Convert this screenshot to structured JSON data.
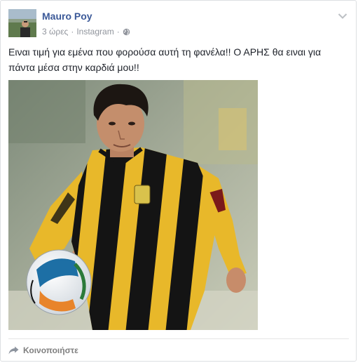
{
  "post": {
    "author": "Mauro Poy",
    "time": "3 ώρες",
    "source": "Instagram",
    "separator": "·",
    "privacy_icon": "globe-icon",
    "menu_icon": "chevron-down-icon",
    "text": "Ειναι τιμή για εμένα που φορούσα αυτή τη φανέλα!! Ο ΑΡΗΣ θα ειναι για πάντα μέσα στην καρδιά μου!!",
    "photo_subject": "footballer in yellow and black striped jersey with a football"
  },
  "footer": {
    "share_label": "Κοινοποιήστε",
    "share_icon": "share-arrow-icon"
  },
  "colors": {
    "author": "#3b5998",
    "meta": "#90949c",
    "text": "#1d2129",
    "jersey_yellow": "#e8b82a",
    "jersey_black": "#141414"
  }
}
